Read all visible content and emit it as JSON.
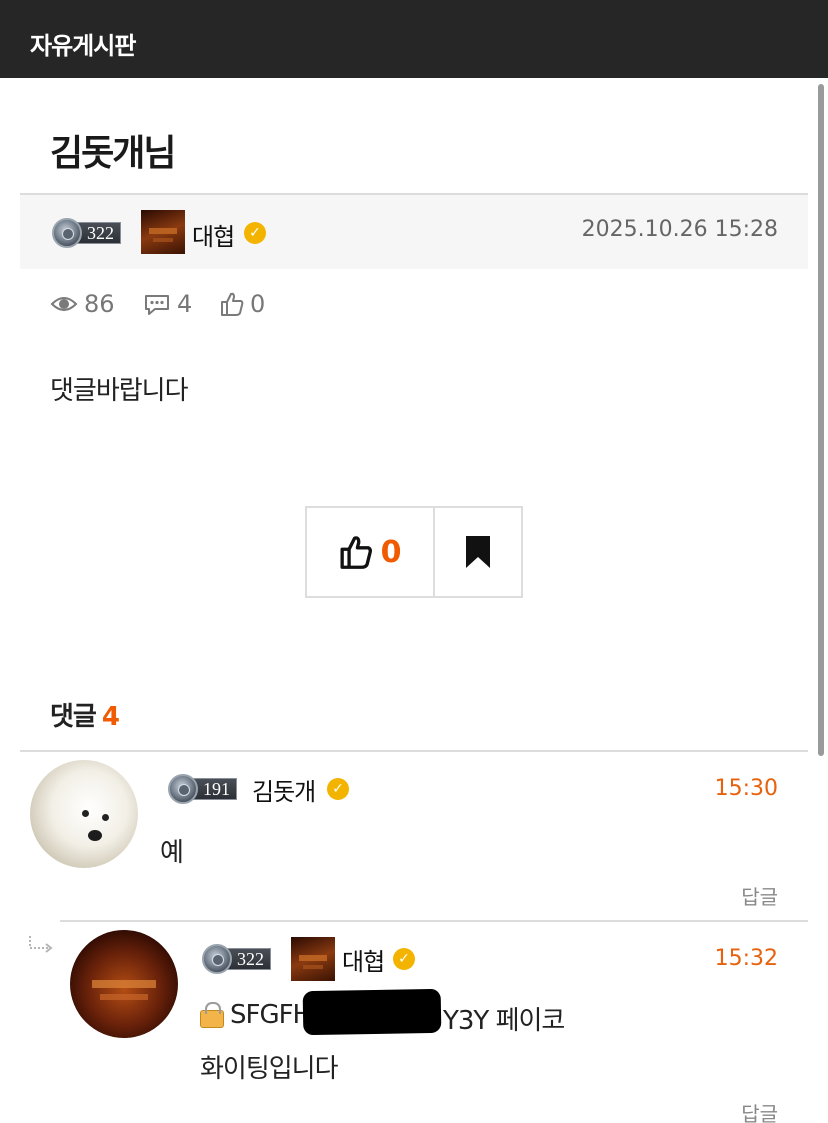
{
  "board": {
    "title": "자유게시판"
  },
  "post": {
    "title": "김돗개님",
    "author": {
      "level": "322",
      "nickname": "대협"
    },
    "date": "2025.10.26 15:28",
    "stats": {
      "views": "86",
      "comments": "4",
      "likes": "0"
    },
    "body": "댓글바랍니다"
  },
  "actions": {
    "like_count": "0"
  },
  "comments_section": {
    "label": "댓글",
    "count": "4",
    "items": [
      {
        "level": "191",
        "nickname": "김돗개",
        "time": "15:30",
        "text": "예",
        "reply_label": "답글"
      },
      {
        "is_reply": true,
        "level": "322",
        "nickname": "대협",
        "time": "15:32",
        "text_prefix": "SFGFH",
        "text_suffix": "Y3Y  페이코",
        "text_line2": "화이팅입니다",
        "reply_label": "답글"
      }
    ]
  },
  "colors": {
    "accent": "#f05a00",
    "topbar": "#262626",
    "verify": "#f3b400"
  },
  "icons": [
    "eye-icon",
    "comment-icon",
    "thumbs-up-icon",
    "bookmark-icon",
    "verified-icon",
    "lock-icon",
    "reply-arrow-icon"
  ]
}
